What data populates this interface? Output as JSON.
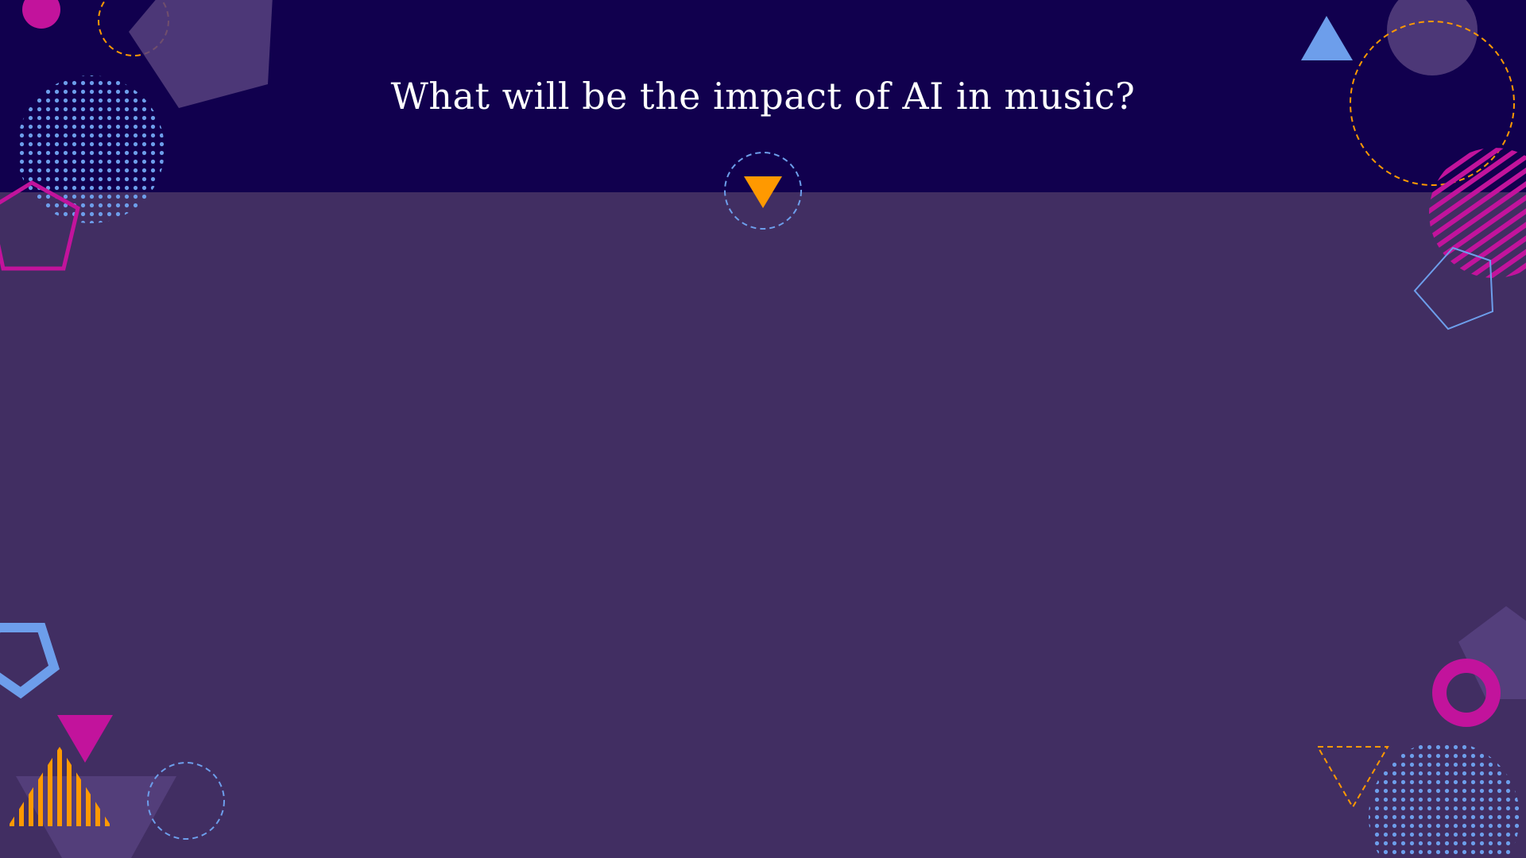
{
  "slide": {
    "title": "What will be the impact of AI in music?"
  },
  "colors": {
    "title_band": "#11004e",
    "body": "#412e62",
    "title_text": "#ffffff",
    "magenta": "#c2139c",
    "blue": "#6d9eeb",
    "orange": "#ff9900",
    "muted_purple": "#57417f"
  },
  "icons": {
    "section_marker": "down-triangle-in-dashed-circle"
  }
}
